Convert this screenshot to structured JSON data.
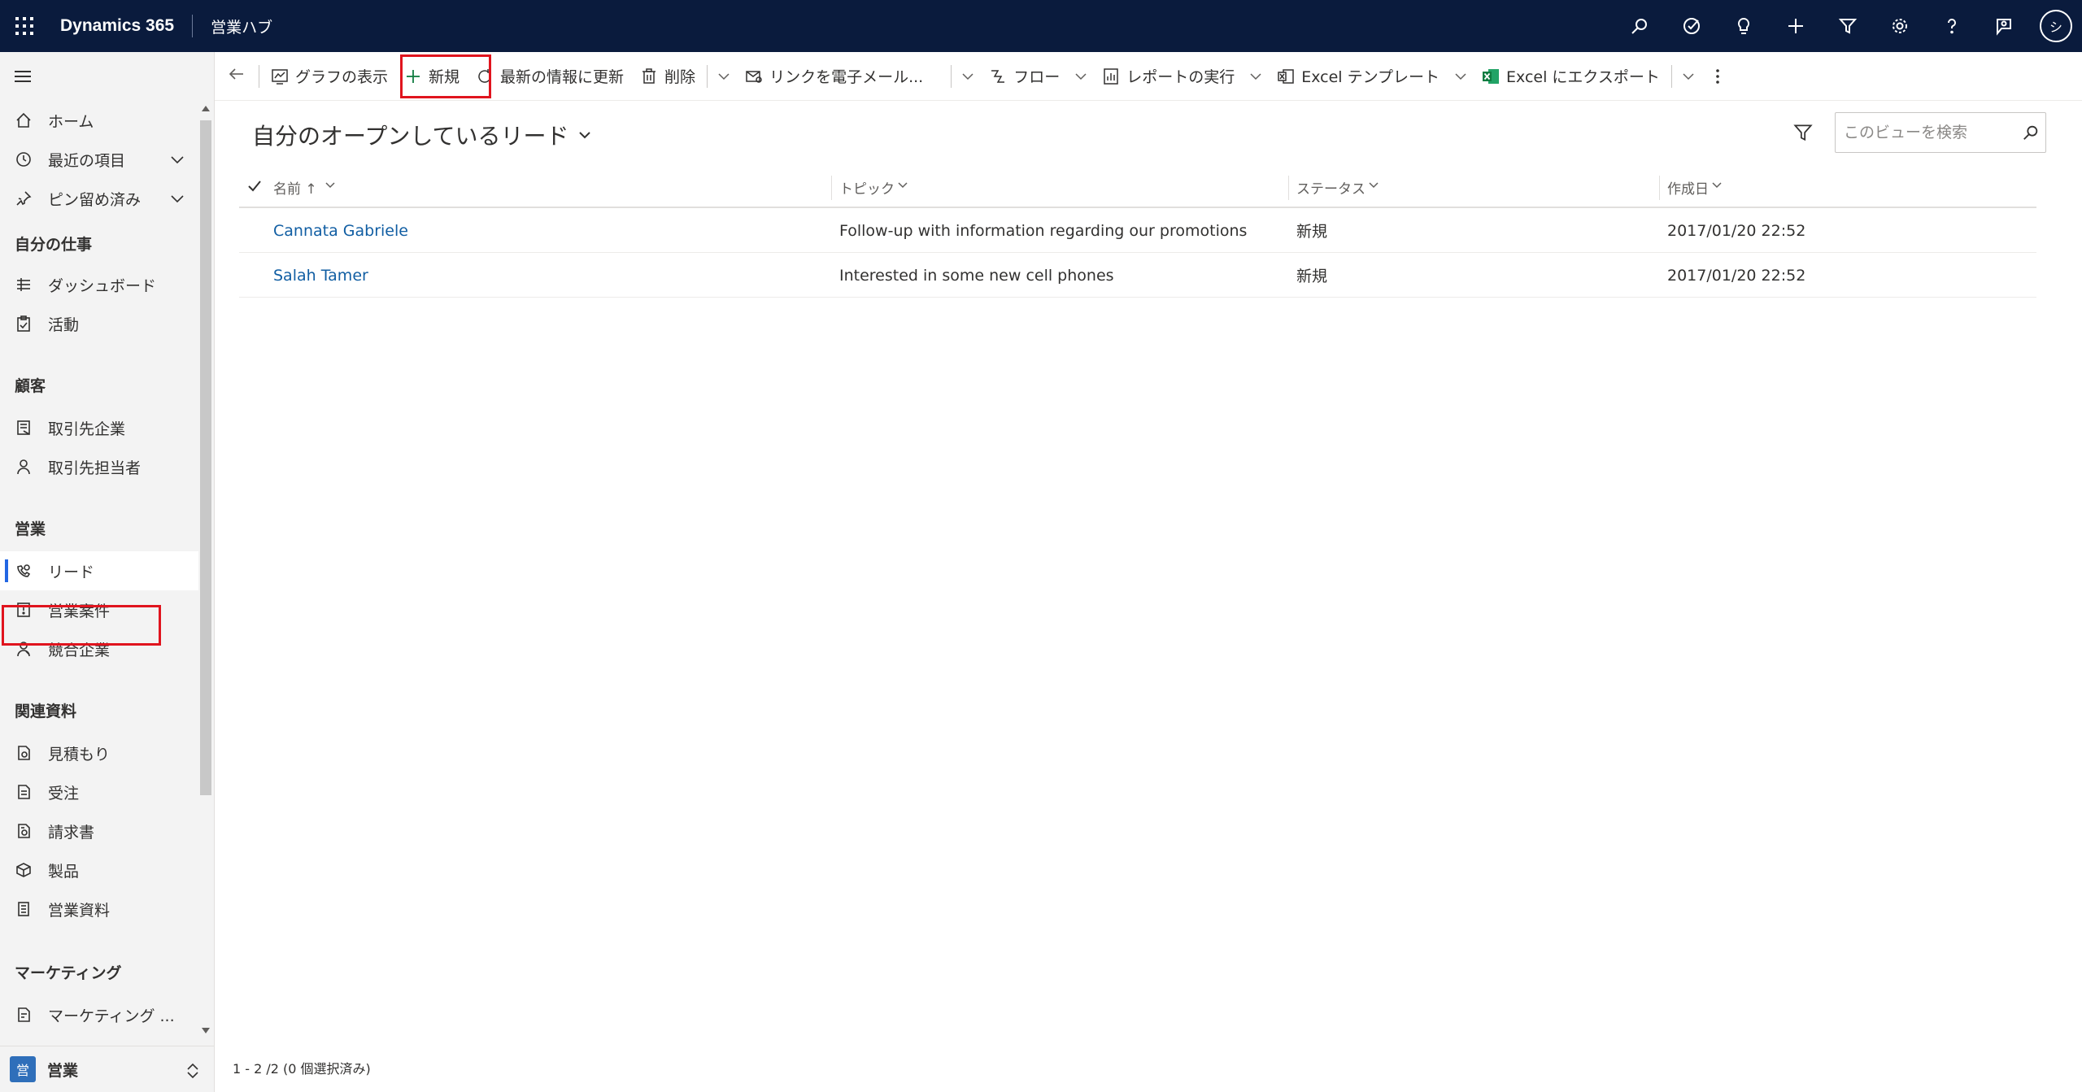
{
  "topbar": {
    "app_name": "Dynamics 365",
    "hub_name": "営業ハブ",
    "avatar_initial": "シ",
    "icons": [
      "search-icon",
      "task-check-icon",
      "lightbulb-icon",
      "plus-icon",
      "filter-icon",
      "gear-icon",
      "help-icon",
      "feedback-icon"
    ]
  },
  "sidebar": {
    "top_items": [
      {
        "label": "ホーム",
        "icon": "home-icon"
      },
      {
        "label": "最近の項目",
        "icon": "clock-icon"
      },
      {
        "label": "ピン留め済み",
        "icon": "pin-icon"
      }
    ],
    "sections": [
      {
        "title": "自分の仕事",
        "items": [
          {
            "label": "ダッシュボード",
            "icon": "dashboard-icon"
          },
          {
            "label": "活動",
            "icon": "activity-icon"
          }
        ]
      },
      {
        "title": "顧客",
        "items": [
          {
            "label": "取引先企業",
            "icon": "account-icon"
          },
          {
            "label": "取引先担当者",
            "icon": "contact-icon"
          }
        ]
      },
      {
        "title": "営業",
        "items": [
          {
            "label": "リード",
            "icon": "lead-icon",
            "selected": true
          },
          {
            "label": "営業案件",
            "icon": "opportunity-icon"
          },
          {
            "label": "競合企業",
            "icon": "competitor-icon"
          }
        ]
      },
      {
        "title": "関連資料",
        "items": [
          {
            "label": "見積もり",
            "icon": "quote-icon"
          },
          {
            "label": "受注",
            "icon": "order-icon"
          },
          {
            "label": "請求書",
            "icon": "invoice-icon"
          },
          {
            "label": "製品",
            "icon": "product-icon"
          },
          {
            "label": "営業資料",
            "icon": "sales-literature-icon"
          }
        ]
      },
      {
        "title": "マーケティング",
        "items": [
          {
            "label": "マーケティング ...",
            "icon": "marketing-list-icon"
          }
        ]
      }
    ],
    "area": {
      "badge": "営",
      "label": "営業"
    }
  },
  "commandbar": {
    "show_chart": "グラフの表示",
    "new": "新規",
    "refresh": "最新の情報に更新",
    "delete": "削除",
    "email_link": "リンクを電子メール...",
    "flow": "フロー",
    "run_report": "レポートの実行",
    "excel_template": "Excel テンプレート",
    "export_excel": "Excel にエクスポート"
  },
  "view": {
    "title": "自分のオープンしているリード",
    "search_placeholder": "このビューを検索"
  },
  "grid": {
    "columns": [
      "名前 ↑",
      "トピック",
      "ステータス",
      "作成日"
    ],
    "rows": [
      {
        "name": "Cannata Gabriele",
        "topic": "Follow-up with information regarding our promotions",
        "status": "新規",
        "created": "2017/01/20 22:52"
      },
      {
        "name": "Salah Tamer",
        "topic": "Interested in some new cell phones",
        "status": "新規",
        "created": "2017/01/20 22:52"
      }
    ],
    "footer": "1 - 2 /2 (0 個選択済み)"
  },
  "colors": {
    "topbar": "#0a1b3d",
    "link": "#115ea3",
    "highlight_border": "#e0141e",
    "selected_accent": "#2266e3",
    "excel_green": "#107c41"
  }
}
